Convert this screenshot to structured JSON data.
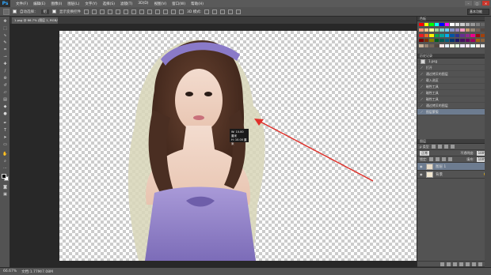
{
  "app": {
    "logo": "Ps"
  },
  "menu": [
    "文件(F)",
    "编辑(E)",
    "图像(I)",
    "图层(L)",
    "文字(Y)",
    "选择(S)",
    "滤镜(T)",
    "3D(D)",
    "视图(V)",
    "窗口(W)",
    "帮助(H)"
  ],
  "window_controls": {
    "minimize": "–",
    "maximize": "□",
    "close": "✕"
  },
  "options": {
    "auto_select_label": "自动选择：",
    "auto_select_value": "组",
    "show_transform": "显示变换控件",
    "workspace": "基本功能"
  },
  "doc_tab": {
    "label": "1.psg @ 66.7% (图层 1, RGB/8) *"
  },
  "tooltip": {
    "line1": "W: 10.00 厘米",
    "line2": "H: 10.00 厘米"
  },
  "status": {
    "zoom": "66.67%",
    "docinfo": "文档:1.77M/7.08M"
  },
  "panels": {
    "swatches_title": "色板",
    "history_title": "历史记录",
    "history_file": "1.psg",
    "history": [
      "打开",
      "通过拷贝的图层",
      "载入选区",
      "磁性工具",
      "磁性工具",
      "磁性工具",
      "通过拷贝的图层",
      "图层蒙版"
    ],
    "history_selected": 7,
    "layers_title": "图层",
    "blend_mode": "正常",
    "opacity_label": "不透明度:",
    "opacity_value": "100%",
    "lock_label": "锁定:",
    "fill_label": "填充:",
    "fill_value": "100%",
    "layers": [
      {
        "name": "图层 1",
        "selected": true
      },
      {
        "name": "背景",
        "selected": false
      }
    ]
  },
  "colors": {
    "accent": "#6d7c90",
    "arrow": "#e0302a",
    "swatches": [
      "#ff0000",
      "#ffff00",
      "#00ff00",
      "#00ffff",
      "#0000ff",
      "#ff00ff",
      "#ffffff",
      "#e6e6e6",
      "#cccccc",
      "#b3b3b3",
      "#999999",
      "#808080",
      "#666666",
      "#000000",
      "#f7977a",
      "#fdc68a",
      "#fff79a",
      "#a2d39c",
      "#7bcdc8",
      "#6ecff6",
      "#8493ca",
      "#a187be",
      "#f49ac2",
      "#c69c6d",
      "#998675",
      "#736357",
      "#534741",
      "#362f2d",
      "#ed1c24",
      "#f26522",
      "#fff200",
      "#00a651",
      "#00a99d",
      "#00aeef",
      "#0054a6",
      "#2e3192",
      "#662d91",
      "#92278f",
      "#ec008c",
      "#9e0b0f",
      "#a0410d",
      "#598527",
      "#790000",
      "#7b2e00",
      "#827b00",
      "#005e20",
      "#005952",
      "#005b7f",
      "#003471",
      "#1b1464",
      "#440e62",
      "#630460",
      "#9e005d",
      "#a36209",
      "#8c6239",
      "#754c24",
      "#c7b299",
      "#998675",
      "#736357",
      "#534741",
      "#ffe6e6",
      "#e6f0ff",
      "#ffffe6",
      "#e6ffe6",
      "#f0e6ff",
      "#ffe6f5",
      "#e6fffa",
      "#fff0e6",
      "#e0e0e0",
      "#404040"
    ]
  },
  "icons": [
    "move-tool",
    "marquee-tool",
    "lasso-tool",
    "quick-select-tool",
    "crop-tool",
    "eyedropper-tool",
    "healing-tool",
    "brush-tool",
    "clone-tool",
    "history-brush-tool",
    "eraser-tool",
    "gradient-tool",
    "blur-tool",
    "dodge-tool",
    "pen-tool",
    "type-tool",
    "path-select-tool",
    "shape-tool",
    "hand-tool",
    "zoom-tool"
  ]
}
